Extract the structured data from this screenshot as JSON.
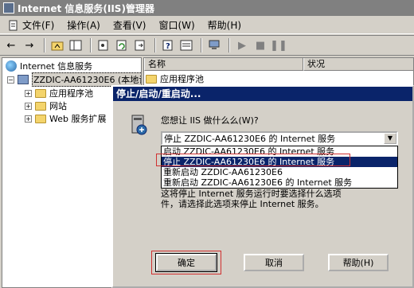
{
  "window": {
    "title": "Internet 信息服务(IIS)管理器"
  },
  "menu": [
    {
      "label": "文件(F)",
      "icon": "document-icon"
    },
    {
      "label": "操作(A)",
      "icon": ""
    },
    {
      "label": "查看(V)",
      "icon": ""
    },
    {
      "label": "窗口(W)",
      "icon": ""
    },
    {
      "label": "帮助(H)",
      "icon": ""
    }
  ],
  "toolbar": {
    "icons": [
      "back-arrow-icon",
      "forward-arrow-icon",
      "up-folder-icon",
      "show-tree-icon",
      "properties-icon",
      "refresh-icon",
      "export-icon",
      "help-icon",
      "console-icon",
      "computer-icon",
      "play-icon",
      "stop-icon",
      "pause-icon"
    ]
  },
  "tree": {
    "root": "Internet 信息服务",
    "server": "ZZDIC-AA61230E6 (本地计",
    "children": [
      "应用程序池",
      "网站",
      "Web 服务扩展"
    ]
  },
  "list": {
    "columns": [
      "名称",
      "状况"
    ],
    "rows": [
      "应用程序池"
    ]
  },
  "dialog": {
    "title": "停止/启动/重启动...",
    "question": "您想让 IIS 做什么么(W)?",
    "combo_value": "停止 ZZDIC-AA61230E6 的 Internet 服务",
    "options": [
      "启动 ZZDIC-AA61230E6 的 Internet 服务",
      "停止 ZZDIC-AA61230E6 的 Internet 服务",
      "重新启动 ZZDIC-AA61230E6",
      "重新启动 ZZDIC-AA61230E6 的 Internet 服务"
    ],
    "selected_option_index": 1,
    "desc_line1": "这将停止 Internet 服务运行时要选择什么选项",
    "desc_line2": "件，请选择此选项来停止 Internet 服务。",
    "ok_label": "确定",
    "cancel_label": "取消",
    "help_label": "帮助(H)",
    "highlight_color": "#d03030"
  }
}
